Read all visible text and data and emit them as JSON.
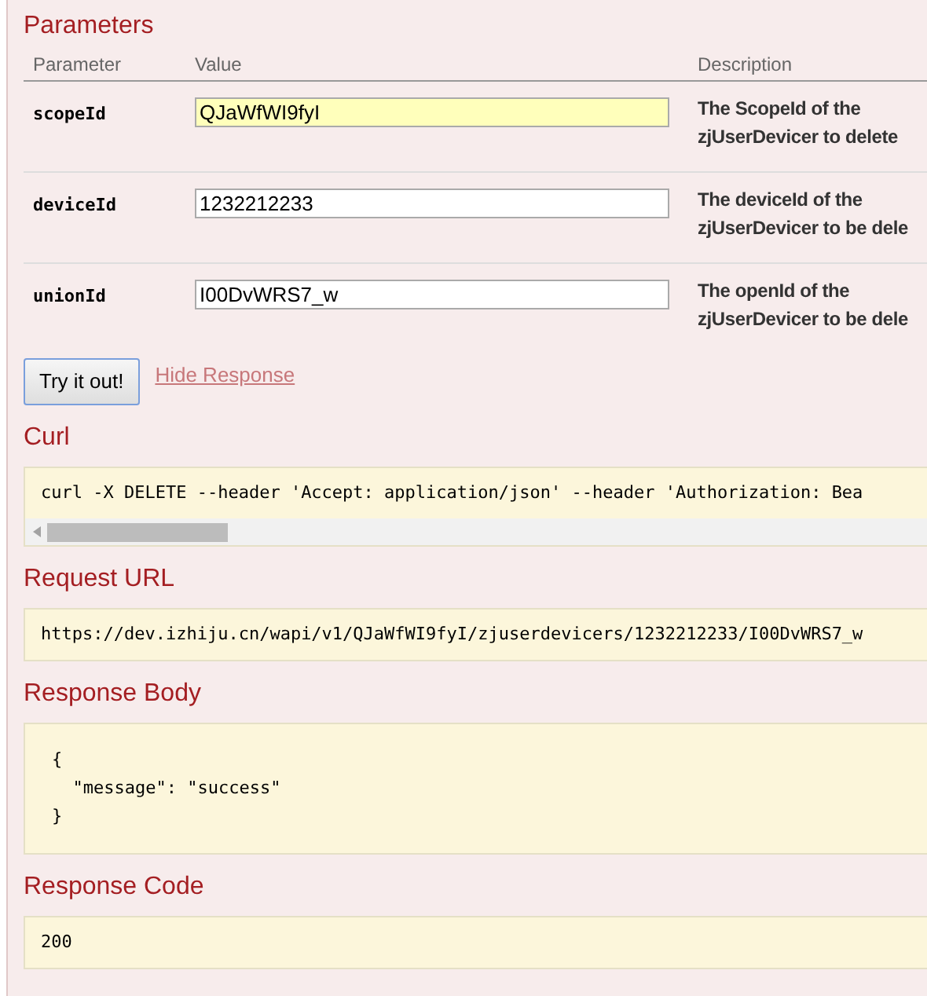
{
  "parameters": {
    "title": "Parameters",
    "columns": [
      "Parameter",
      "Value",
      "Description"
    ],
    "rows": [
      {
        "name": "scopeId",
        "value": "QJaWfWI9fyI",
        "highlighted": true,
        "description": [
          "The ScopeId of the",
          "zjUserDevicer to delete"
        ]
      },
      {
        "name": "deviceId",
        "value": "1232212233",
        "highlighted": false,
        "description": [
          "The deviceId of the",
          "zjUserDevicer to be dele"
        ]
      },
      {
        "name": "unionId",
        "value": "I00DvWRS7_w",
        "highlighted": false,
        "description": [
          "The openId of the",
          "zjUserDevicer to be dele"
        ]
      }
    ]
  },
  "try_button": "Try it out!",
  "hide_link": "Hide Response",
  "sections": [
    {
      "kind": "scroll",
      "title": "Curl",
      "lines": [
        "curl -X DELETE --header 'Accept: application/json' --header 'Authorization: Bea"
      ]
    },
    {
      "kind": "plain",
      "title": "Request URL",
      "lines": [
        "https://dev.izhiju.cn/wapi/v1/QJaWfWI9fyI/zjuserdevicers/1232212233/I00DvWRS7_w"
      ]
    },
    {
      "kind": "body",
      "title": "Response Body",
      "lines": [
        "{",
        "  \"message\": \"success\"",
        "}"
      ]
    },
    {
      "kind": "plain",
      "title": "Response Code",
      "lines": [
        "200"
      ]
    }
  ]
}
